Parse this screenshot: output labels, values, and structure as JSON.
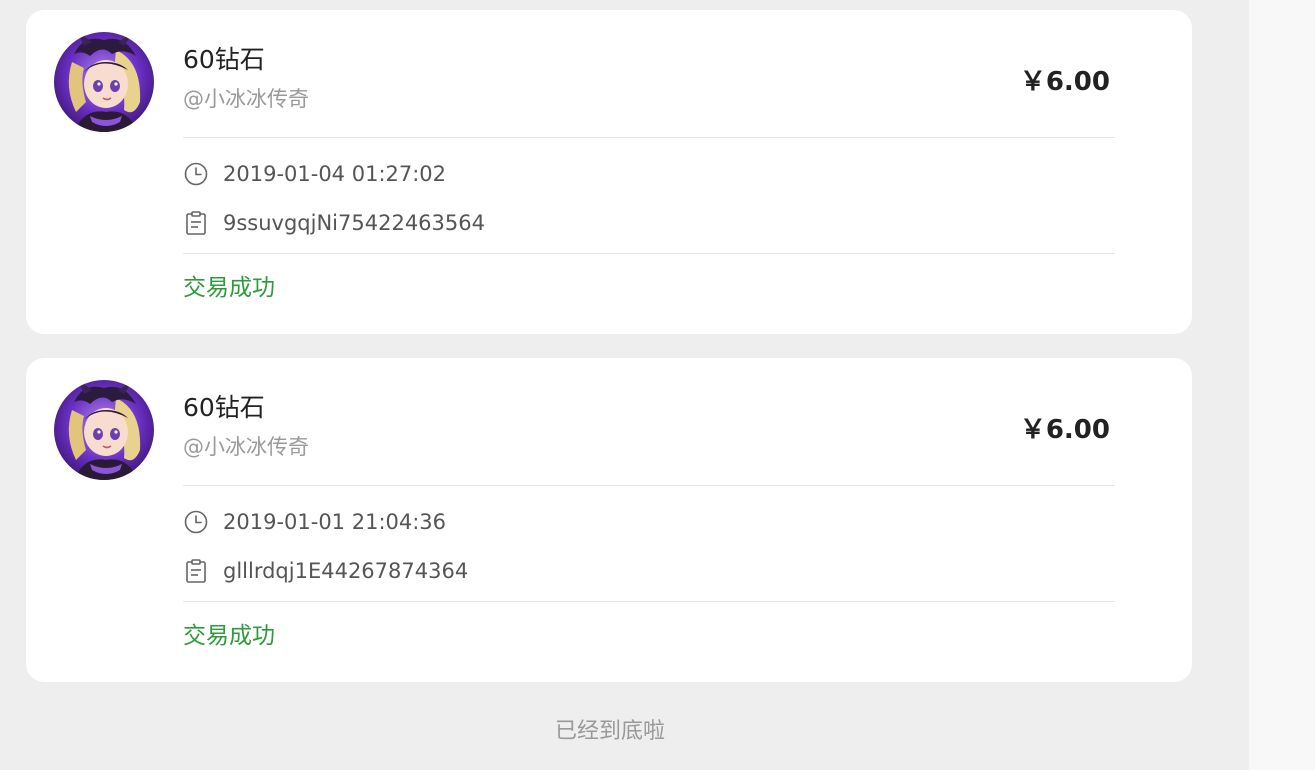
{
  "orders": [
    {
      "title": "60钻石",
      "seller": "@小冰冰传奇",
      "price": "￥6.00",
      "time": "2019-01-04 01:27:02",
      "order_id": "9ssuvgqjNi75422463564",
      "status": "交易成功",
      "avatar_icon": "game-character-avatar",
      "time_icon": "clock-icon",
      "order_icon": "clipboard-icon"
    },
    {
      "title": "60钻石",
      "seller": "@小冰冰传奇",
      "price": "￥6.00",
      "time": "2019-01-01 21:04:36",
      "order_id": "glllrdqj1E44267874364",
      "status": "交易成功",
      "avatar_icon": "game-character-avatar",
      "time_icon": "clock-icon",
      "order_icon": "clipboard-icon"
    }
  ],
  "footer": {
    "end_text": "已经到底啦"
  },
  "colors": {
    "background": "#eeeeee",
    "card": "#ffffff",
    "status_success": "#2e9b3a",
    "muted_text": "#9a9a9a"
  }
}
